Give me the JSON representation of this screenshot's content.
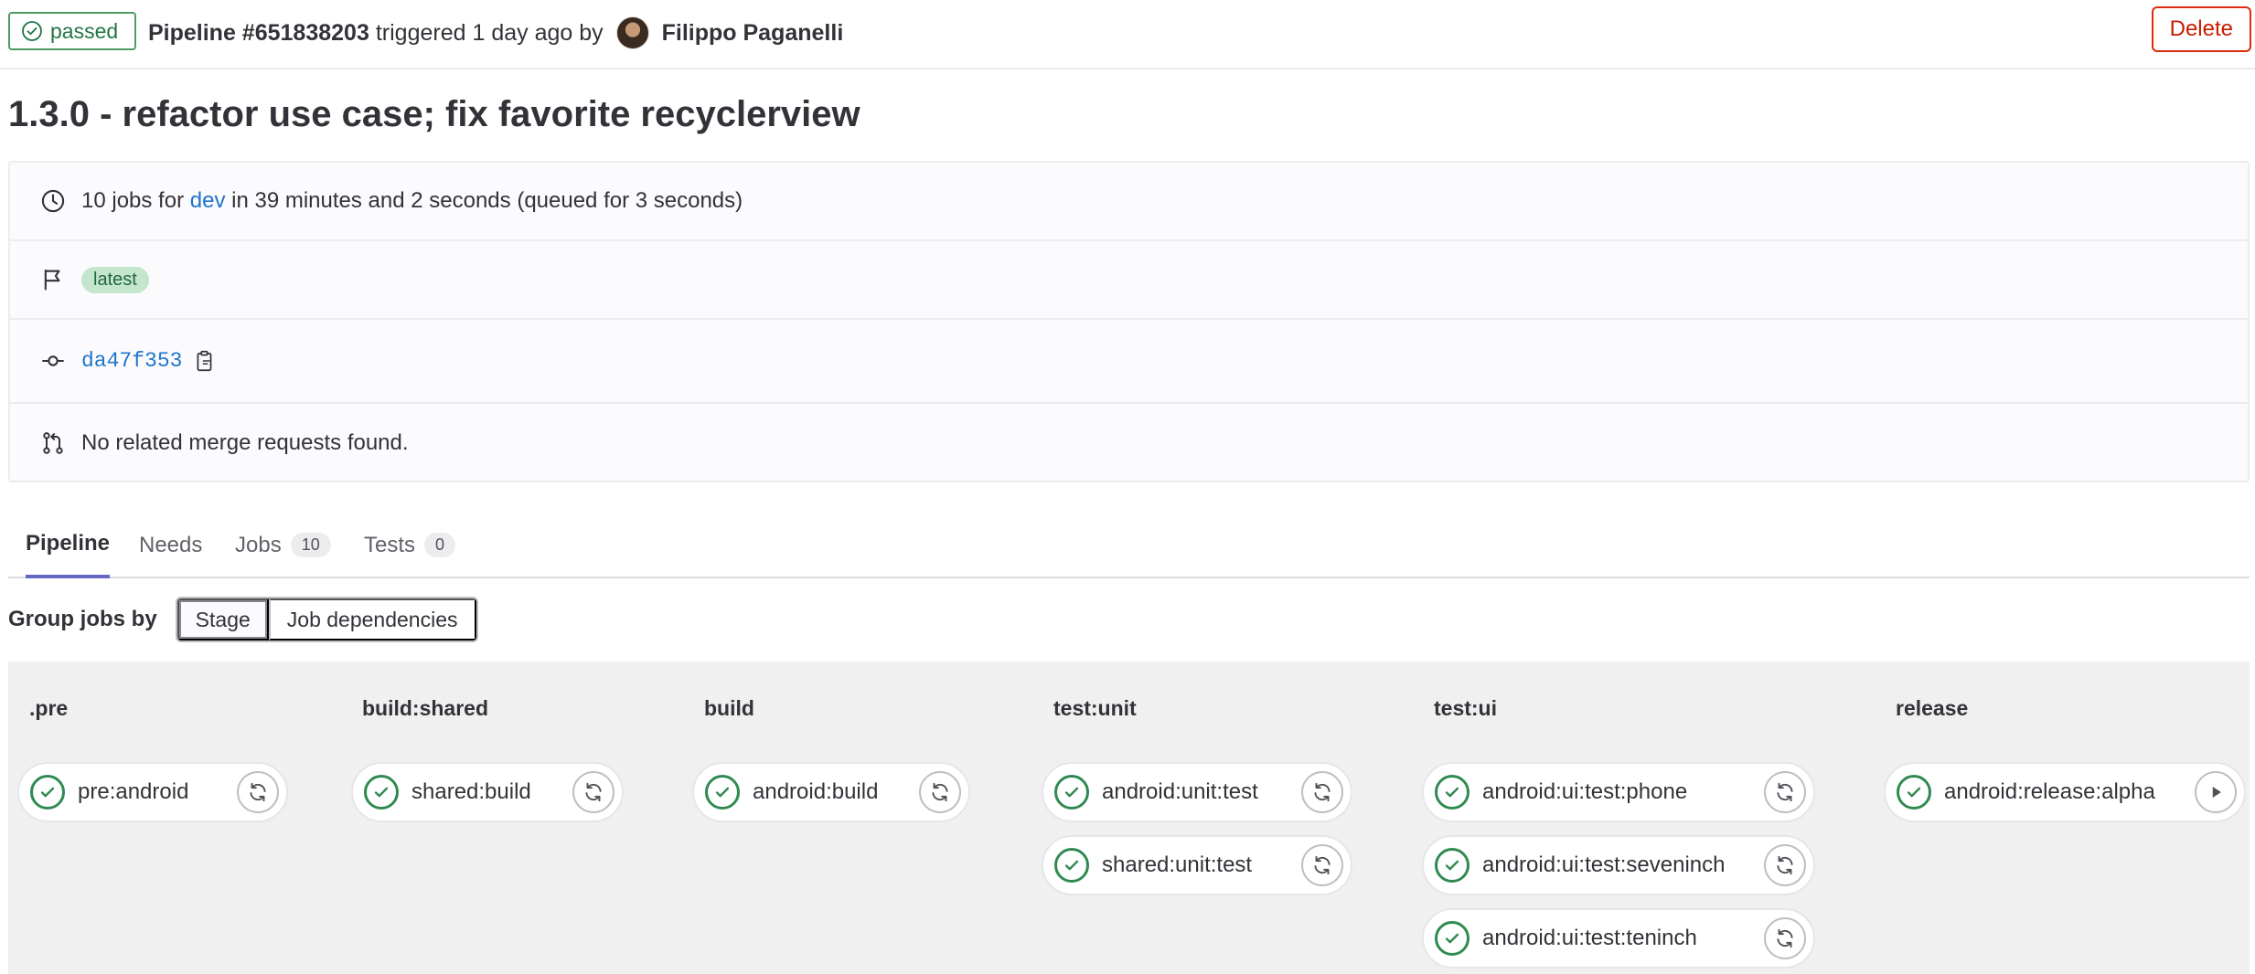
{
  "header": {
    "status_label": "passed",
    "status_icon": "status-success-icon",
    "pipeline_id": "Pipeline #651838203",
    "triggered_text": "triggered 1 day ago by",
    "author": "Filippo Paganelli",
    "delete_label": "Delete"
  },
  "title": "1.3.0 - refactor use case; fix favorite recyclerview",
  "info": {
    "jobs_prefix": "10 jobs for",
    "branch": "dev",
    "jobs_suffix": "in 39 minutes and 2 seconds (queued for 3 seconds)",
    "latest_badge": "latest",
    "commit_sha": "da47f353",
    "merge_requests": "No related merge requests found."
  },
  "tabs": [
    {
      "label": "Pipeline",
      "active": true
    },
    {
      "label": "Needs"
    },
    {
      "label": "Jobs",
      "count": "10"
    },
    {
      "label": "Tests",
      "count": "0"
    }
  ],
  "group_by": {
    "label": "Group jobs by",
    "options": [
      "Stage",
      "Job dependencies"
    ],
    "selected": "Stage"
  },
  "stages": [
    {
      "name": ".pre",
      "jobs": [
        {
          "name": "pre:android",
          "action": "retry"
        }
      ]
    },
    {
      "name": "build:shared",
      "jobs": [
        {
          "name": "shared:build",
          "action": "retry"
        }
      ]
    },
    {
      "name": "build",
      "jobs": [
        {
          "name": "android:build",
          "action": "retry"
        }
      ]
    },
    {
      "name": "test:unit",
      "jobs": [
        {
          "name": "android:unit:test",
          "action": "retry"
        },
        {
          "name": "shared:unit:test",
          "action": "retry"
        }
      ]
    },
    {
      "name": "test:ui",
      "jobs": [
        {
          "name": "android:ui:test:phone",
          "action": "retry"
        },
        {
          "name": "android:ui:test:seveninch",
          "action": "retry"
        },
        {
          "name": "android:ui:test:teninch",
          "action": "retry"
        }
      ]
    },
    {
      "name": "release",
      "jobs": [
        {
          "name": "android:release:alpha",
          "action": "play"
        }
      ]
    }
  ],
  "colors": {
    "success": "#217645",
    "danger": "#dd2b0e",
    "link": "#1f75cb",
    "active_tab": "#6666c4"
  }
}
